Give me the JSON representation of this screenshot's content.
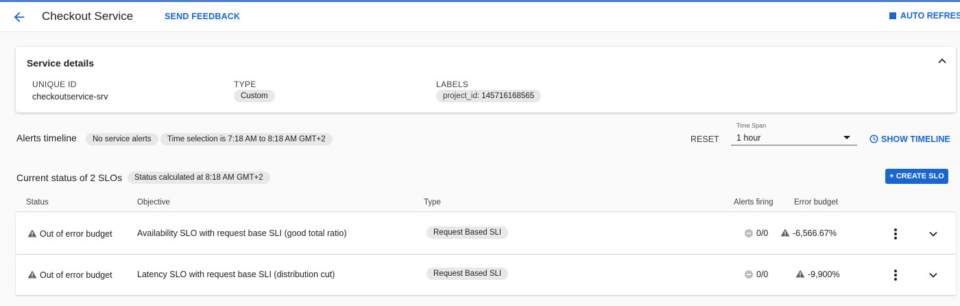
{
  "header": {
    "title": "Checkout Service",
    "feedback_label": "SEND FEEDBACK",
    "auto_refresh_label": "AUTO REFRESH",
    "back_icon": "arrow-back-icon"
  },
  "service_details": {
    "title": "Service details",
    "unique_id_label": "UNIQUE ID",
    "unique_id_value": "checkoutservice-srv",
    "type_label": "TYPE",
    "type_value": "Custom",
    "labels_label": "LABELS",
    "label_key": "project_id:",
    "label_value": "145716168565"
  },
  "alerts_timeline": {
    "title": "Alerts timeline",
    "chip_alerts": "No service alerts",
    "chip_time": "Time selection is 7:18 AM to 8:18 AM GMT+2",
    "reset_label": "RESET",
    "timespan_label": "Time Span",
    "timespan_value": "1 hour",
    "show_timeline_label": "SHOW TIMELINE"
  },
  "slo": {
    "title": "Current status of 2 SLOs",
    "status_chip": "Status calculated at 8:18 AM GMT+2",
    "create_label": "+ CREATE SLO",
    "columns": {
      "status": "Status",
      "objective": "Objective",
      "type": "Type",
      "alerts": "Alerts firing",
      "budget": "Error budget"
    },
    "rows": [
      {
        "status": "Out of error budget",
        "objective": "Availability SLO with request base SLI (good total ratio)",
        "type": "Request Based SLI",
        "alerts": "0/0",
        "budget": "-6,566.67%"
      },
      {
        "status": "Out of error budget",
        "objective": "Latency SLO with request base SLI (distribution cut)",
        "type": "Request Based SLI",
        "alerts": "0/0",
        "budget": "-9,900%"
      }
    ]
  },
  "colors": {
    "accent": "#1a66d0",
    "chip_bg": "#e8e8e8",
    "warning_icon": "#5f6368"
  }
}
